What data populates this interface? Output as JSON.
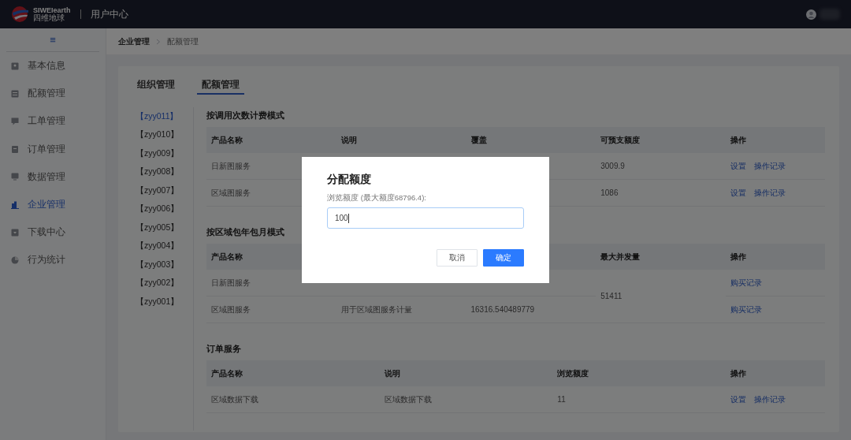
{
  "header": {
    "logo_text": "SIWEIearth",
    "logo_subtext": "四维地球",
    "title": "用户中心"
  },
  "sidebar": {
    "toggle": "≡",
    "items": [
      {
        "label": "基本信息",
        "kind": "profile",
        "selected": false
      },
      {
        "label": "配额管理",
        "kind": "list",
        "selected": false
      },
      {
        "label": "工单管理",
        "kind": "message",
        "selected": false
      },
      {
        "label": "订单管理",
        "kind": "clipboard",
        "selected": false
      },
      {
        "label": "数据管理",
        "kind": "monitor",
        "selected": false
      },
      {
        "label": "企业管理",
        "kind": "building",
        "selected": true
      },
      {
        "label": "下载中心",
        "kind": "download",
        "selected": false
      },
      {
        "label": "行为统计",
        "kind": "pie",
        "selected": false
      }
    ]
  },
  "breadcrumb": [
    "企业管理",
    "配额管理"
  ],
  "tabs": [
    {
      "label": "组织管理",
      "selected": false
    },
    {
      "label": "配额管理",
      "selected": true
    }
  ],
  "organizations": [
    {
      "label": "【zyy011】",
      "selected": true
    },
    {
      "label": "【zyy010】",
      "selected": false
    },
    {
      "label": "【zyy009】",
      "selected": false
    },
    {
      "label": "【zyy008】",
      "selected": false
    },
    {
      "label": "【zyy007】",
      "selected": false
    },
    {
      "label": "【zyy006】",
      "selected": false
    },
    {
      "label": "【zyy005】",
      "selected": false
    },
    {
      "label": "【zyy004】",
      "selected": false
    },
    {
      "label": "【zyy003】",
      "selected": false
    },
    {
      "label": "【zyy002】",
      "selected": false
    },
    {
      "label": "【zyy001】",
      "selected": false
    }
  ],
  "sections": [
    {
      "title": "按调用次数计费模式",
      "columns": [
        "产品名称",
        "说明",
        "覆盖",
        "可预支额度",
        "操作"
      ],
      "rows": [
        {
          "cells": [
            {
              "text": "日新图服务"
            },
            null,
            null,
            {
              "text": "3009.9"
            }
          ],
          "actions": [
            "设置",
            "操作记录"
          ]
        },
        {
          "cells": [
            {
              "text": "区域图服务"
            },
            null,
            null,
            {
              "text": "1086"
            }
          ],
          "actions": [
            "设置",
            "操作记录"
          ]
        }
      ]
    },
    {
      "title": "按区域包年包月模式",
      "columns": [
        "产品名称",
        null,
        null,
        "最大并发量",
        "操作"
      ],
      "rows": [
        {
          "cells": [
            {
              "text": "日新图服务"
            },
            null,
            null,
            {
              "text": "51411",
              "rowspan": 2
            }
          ],
          "actions": [
            "购买记录"
          ]
        },
        {
          "cells": [
            {
              "text": "区域图服务"
            },
            {
              "text": "用于区域图服务计量"
            },
            {
              "text": "16316.540489779"
            }
          ],
          "actions": [
            "购买记录"
          ]
        }
      ]
    },
    {
      "title": "订单服务",
      "columns": [
        "产品名称",
        "说明",
        "浏览额度",
        "操作"
      ],
      "rows": [
        {
          "cells": [
            {
              "text": "区域数据下载"
            },
            {
              "text": "区域数据下载"
            },
            {
              "text": "11"
            }
          ],
          "actions": [
            "设置",
            "操作记录"
          ]
        }
      ]
    }
  ],
  "dialog": {
    "title": "分配额度",
    "field_label": "浏览额度 (最大额度68796.4):",
    "value": "100",
    "buttons": [
      {
        "label": "取消",
        "kind": "secondary"
      },
      {
        "label": "确定",
        "kind": "primary"
      }
    ]
  }
}
